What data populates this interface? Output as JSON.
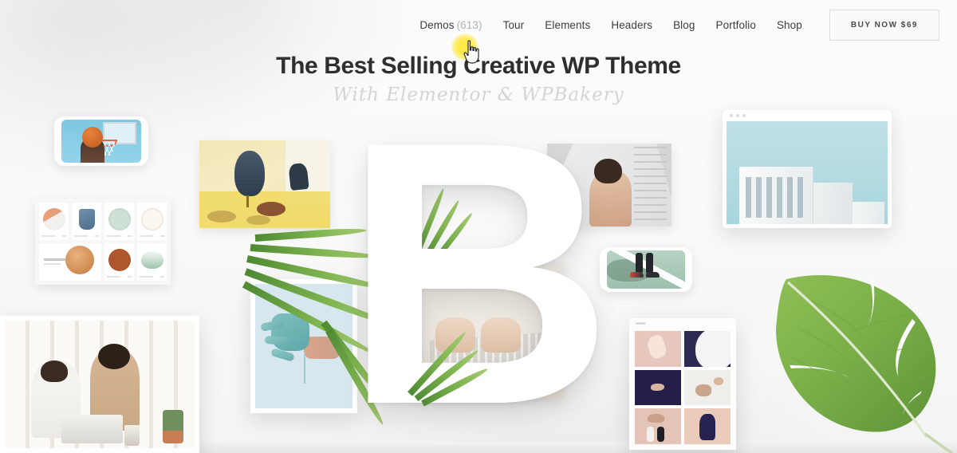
{
  "header": {
    "nav_items": [
      {
        "label": "Demos",
        "count": "(613)"
      },
      {
        "label": "Tour",
        "count": ""
      },
      {
        "label": "Elements",
        "count": ""
      },
      {
        "label": "Headers",
        "count": ""
      },
      {
        "label": "Blog",
        "count": ""
      },
      {
        "label": "Portfolio",
        "count": ""
      },
      {
        "label": "Shop",
        "count": ""
      }
    ],
    "buy_button": "BUY NOW $69"
  },
  "hero": {
    "title": "The Best Selling Creative WP Theme",
    "subtitle": "With Elementor & WPBakery",
    "letter": "B"
  },
  "cursor": {
    "icon": "pointing-hand-cursor",
    "highlight_color": "#ffe94a"
  },
  "showcase": {
    "items": [
      {
        "name": "basketball-phone-mockup",
        "type": "phone",
        "subject": "Basketball player dunking against blue sky"
      },
      {
        "name": "product-grid-mockup",
        "type": "grid",
        "subject": "Ceramic tableware product listing"
      },
      {
        "name": "office-couple-photo",
        "type": "photo",
        "subject": "Two colleagues working at a laptop"
      },
      {
        "name": "yellow-interior-photo",
        "type": "photo",
        "subject": "Yellow room with designer chairs"
      },
      {
        "name": "teal-hand-artwork",
        "type": "photo",
        "subject": "Hand dipped in teal paint"
      },
      {
        "name": "portrait-back-photo",
        "type": "photo",
        "subject": "Portrait of a figure from behind"
      },
      {
        "name": "architecture-browser-mockup",
        "type": "browser",
        "subject": "White modernist building against blue sky"
      },
      {
        "name": "sneakers-phone-mockup",
        "type": "phone",
        "subject": "Sneakers on a tennis court line"
      },
      {
        "name": "portfolio-grid-mockup",
        "type": "grid",
        "subject": "Pink and navy art portfolio tiles"
      },
      {
        "name": "monstera-leaf-photo",
        "type": "photo",
        "subject": "Monstera leaf on white background"
      },
      {
        "name": "keyboard-typing-photo",
        "type": "photo",
        "subject": "Hands typing on a laptop keyboard"
      }
    ]
  },
  "colors": {
    "page_background": "#fbfbfb",
    "nav_text": "#3c3c3c",
    "nav_count": "#b0b0b0",
    "heading": "#2e2e2e",
    "subtitle": "#d4d4d4",
    "button_border": "#dcdcdc",
    "letter": "#ffffff"
  }
}
